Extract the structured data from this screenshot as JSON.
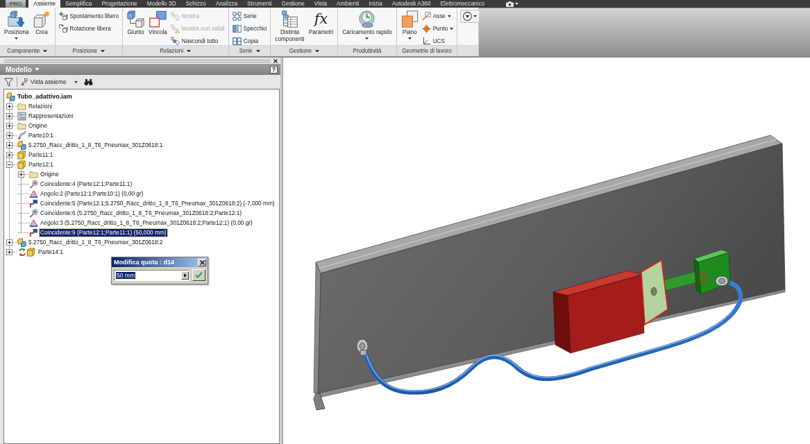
{
  "app_button": {
    "label": "PRO"
  },
  "ribbon_tabs": [
    {
      "label": "Assieme",
      "selected": true
    },
    {
      "label": "Semplifica",
      "selected": false
    },
    {
      "label": "Progettazione",
      "selected": false
    },
    {
      "label": "Modello 3D",
      "selected": false
    },
    {
      "label": "Schizzo",
      "selected": false
    },
    {
      "label": "Analizza",
      "selected": false
    },
    {
      "label": "Strumenti",
      "selected": false
    },
    {
      "label": "Gestione",
      "selected": false
    },
    {
      "label": "Vista",
      "selected": false
    },
    {
      "label": "Ambienti",
      "selected": false
    },
    {
      "label": "Inizia",
      "selected": false
    },
    {
      "label": "Autodesk A360",
      "selected": false
    },
    {
      "label": "Elettromeccanico",
      "selected": false
    }
  ],
  "ribbon": {
    "panels": [
      {
        "title": "Componente",
        "menu": true,
        "tools": [
          {
            "label": "Posiziona",
            "kind": "large",
            "dropdown": true,
            "disabled": false
          },
          {
            "label": "Crea",
            "kind": "large",
            "dropdown": false,
            "disabled": false
          }
        ]
      },
      {
        "title": "Posizione",
        "menu": true,
        "tools": [
          {
            "label": "Spostamento libero",
            "kind": "small",
            "dropdown": false,
            "disabled": false
          },
          {
            "label": "Rotazione libera",
            "kind": "small",
            "dropdown": false,
            "disabled": false
          }
        ]
      },
      {
        "title": "Relazioni",
        "menu": true,
        "tools": [
          {
            "label": "Giunto",
            "kind": "large",
            "dropdown": false,
            "disabled": false
          },
          {
            "label": "Vincola",
            "kind": "large",
            "dropdown": false,
            "disabled": false
          },
          {
            "label": "Mostra",
            "kind": "small",
            "dropdown": false,
            "disabled": true
          },
          {
            "label": "Mostra non validi",
            "kind": "small",
            "dropdown": false,
            "disabled": true
          },
          {
            "label": "Nascondi tutto",
            "kind": "small",
            "dropdown": false,
            "disabled": false
          }
        ]
      },
      {
        "title": "Serie",
        "menu": true,
        "tools": [
          {
            "label": "Serie",
            "kind": "small",
            "dropdown": false,
            "disabled": false
          },
          {
            "label": "Specchio",
            "kind": "small",
            "dropdown": false,
            "disabled": false
          },
          {
            "label": "Copia",
            "kind": "small",
            "dropdown": false,
            "disabled": false
          }
        ]
      },
      {
        "title": "Gestione",
        "menu": true,
        "tools": [
          {
            "label": "Distinta\ncomponenti",
            "kind": "large",
            "dropdown": false,
            "disabled": false
          },
          {
            "label": "Parametri",
            "kind": "large",
            "glyph": "fx",
            "dropdown": false,
            "disabled": false
          }
        ]
      },
      {
        "title": "Produttività",
        "menu": false,
        "tools": [
          {
            "label": "Caricamento rapido",
            "kind": "large",
            "dropdown": true,
            "disabled": false
          }
        ]
      },
      {
        "title": "Geometrie di lavoro",
        "menu": false,
        "tools": [
          {
            "label": "Piano",
            "kind": "large",
            "dropdown": true,
            "disabled": false
          },
          {
            "label": "Asse",
            "kind": "small",
            "dropdown": true,
            "disabled": false
          },
          {
            "label": "Punto",
            "kind": "small",
            "dropdown": true,
            "disabled": false
          },
          {
            "label": "UCS",
            "kind": "small",
            "dropdown": false,
            "disabled": false
          }
        ]
      },
      {
        "tools": [
          {
            "kind": "icon",
            "dropdown": true,
            "disabled": false
          }
        ]
      }
    ]
  },
  "browser": {
    "title": "Modello",
    "help": "?",
    "view_selector": "Vista assieme",
    "tree": [
      {
        "label": "Tubo_adattivo.iam",
        "kind": "assembly",
        "selected": false,
        "children": [
          {
            "label": "Relazioni",
            "kind": "folder",
            "expanded": false,
            "selected": false
          },
          {
            "label": "Rappresentazioni",
            "kind": "representations",
            "expanded": false,
            "selected": false
          },
          {
            "label": "Origine",
            "kind": "folder",
            "expanded": false,
            "selected": false
          },
          {
            "label": "Parte10:1",
            "kind": "tube",
            "expanded": false,
            "selected": false
          },
          {
            "label": "5.2750_Racc_dritto_1_8_T6_Pneumax_301Z0618:1",
            "kind": "assembly",
            "expanded": false,
            "selected": false
          },
          {
            "label": "Parte11:1",
            "kind": "part",
            "expanded": false,
            "selected": false
          },
          {
            "label": "Parte12:1",
            "kind": "part",
            "expanded": true,
            "selected": false,
            "children": [
              {
                "label": "Origine",
                "kind": "folder",
                "expanded": false,
                "selected": false
              },
              {
                "label": "Coincidente:4 (Parte12:1;Parte11:1)",
                "kind": "insert",
                "selected": false
              },
              {
                "label": "Angolo:2 (Parte12:1;Parte10:1) (0,00 gr)",
                "kind": "angle",
                "selected": false
              },
              {
                "label": "Coincidente:5 (Parte12:1;5.2750_Racc_dritto_1_8_T6_Pneumax_301Z0618:2) (-7,000 mm)",
                "kind": "mate",
                "selected": false
              },
              {
                "label": "Coincidente:6 (5.2750_Racc_dritto_1_8_T6_Pneumax_301Z0618:2;Parte12:1)",
                "kind": "insert",
                "selected": false
              },
              {
                "label": "Angolo:3 (5.2750_Racc_dritto_1_8_T6_Pneumax_301Z0618:2;Parte12:1) (0,00 gr)",
                "kind": "angle",
                "selected": false
              },
              {
                "label": "Coincidente:9 (Parte12:1;Parte11:1) (50,000 mm)",
                "kind": "mate",
                "selected": true
              }
            ]
          },
          {
            "label": "5.2750_Racc_dritto_1_8_T6_Pneumax_301Z0618:2",
            "kind": "assembly",
            "expanded": false,
            "selected": false
          },
          {
            "label": "Parte14:1",
            "kind": "adaptive",
            "expanded": false,
            "selected": false
          }
        ]
      }
    ]
  },
  "dimension_dialog": {
    "title": "Modifica quota : d14",
    "value": "50 mm",
    "value_selected": true
  }
}
